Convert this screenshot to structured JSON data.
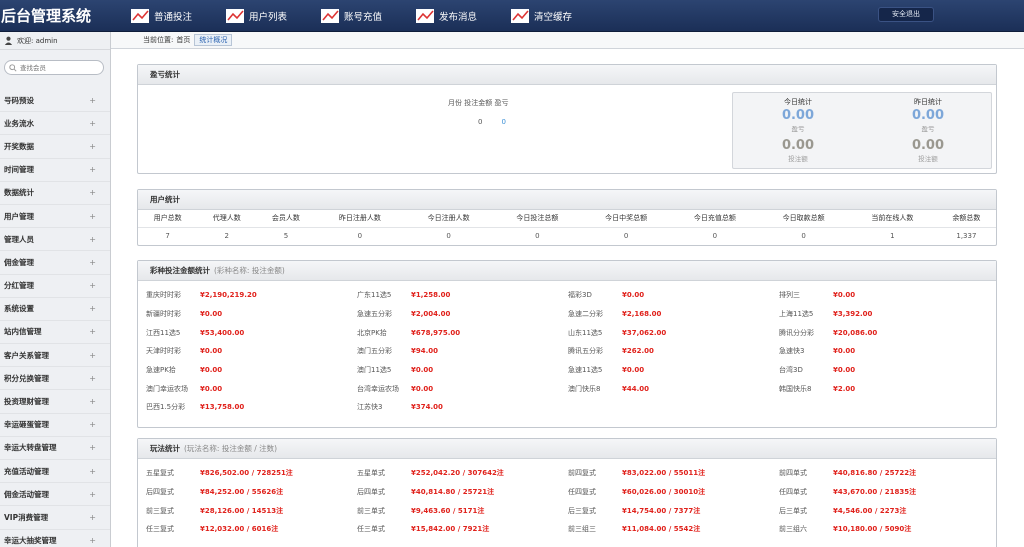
{
  "header": {
    "brand": "后台管理系统",
    "nav": [
      {
        "label": "普通投注",
        "icon": "chart-icon"
      },
      {
        "label": "用户列表",
        "icon": "chart-icon"
      },
      {
        "label": "账号充值",
        "icon": "chart-icon"
      },
      {
        "label": "发布消息",
        "icon": "chart-icon"
      },
      {
        "label": "清空缓存",
        "icon": "chart-icon"
      }
    ],
    "logout": "安全退出"
  },
  "sidebar": {
    "welcome": "欢迎: admin",
    "search_placeholder": "查找会员",
    "items": [
      "号码预设",
      "业务流水",
      "开奖数据",
      "时间管理",
      "数据统计",
      "用户管理",
      "管理人员",
      "佣金管理",
      "分红管理",
      "系统设置",
      "站内信管理",
      "客户关系管理",
      "积分兑换管理",
      "投资理财管理",
      "幸运砸蛋管理",
      "幸运大转盘管理",
      "充值活动管理",
      "佣金活动管理",
      "VIP消费管理",
      "幸运大抽奖管理"
    ]
  },
  "breadcrumb": {
    "prefix": "当前位置:",
    "home": "首页",
    "current": "统计概况"
  },
  "profit": {
    "title": "盈亏统计",
    "mid_header": "月份 投注金额 盈亏",
    "mid_v1": "0",
    "mid_v2": "0",
    "today_label": "今日统计",
    "yesterday_label": "昨日统计",
    "today_profit": "0.00",
    "today_bet": "0.00",
    "yesterday_profit": "0.00",
    "yesterday_bet": "0.00",
    "profit_label": "盈亏",
    "bet_label": "投注额"
  },
  "users": {
    "title": "用户统计",
    "headers": [
      "用户总数",
      "代理人数",
      "会员人数",
      "昨日注册人数",
      "今日注册人数",
      "今日投注总额",
      "今日中奖总额",
      "今日充值总额",
      "今日取款总额",
      "当前在线人数",
      "余额总数"
    ],
    "values": [
      "7",
      "2",
      "5",
      "0",
      "0",
      "0",
      "0",
      "0",
      "0",
      "1",
      "1,337"
    ]
  },
  "lottery": {
    "title": "彩种投注金额统计",
    "subtitle": "(彩种名称: 投注金额)",
    "rows": [
      [
        [
          "重庆时时彩",
          "¥2,190,219.20"
        ],
        [
          "广东11选5",
          "¥1,258.00"
        ],
        [
          "福彩3D",
          "¥0.00"
        ],
        [
          "排列三",
          "¥0.00"
        ]
      ],
      [
        [
          "新疆时时彩",
          "¥0.00"
        ],
        [
          "急速五分彩",
          "¥2,004.00"
        ],
        [
          "急速二分彩",
          "¥2,168.00"
        ],
        [
          "上海11选5",
          "¥3,392.00"
        ]
      ],
      [
        [
          "江西11选5",
          "¥53,400.00"
        ],
        [
          "北京PK拾",
          "¥678,975.00"
        ],
        [
          "山东11选5",
          "¥37,062.00"
        ],
        [
          "腾讯分分彩",
          "¥20,086.00"
        ]
      ],
      [
        [
          "天津时时彩",
          "¥0.00"
        ],
        [
          "澳门五分彩",
          "¥94.00"
        ],
        [
          "腾讯五分彩",
          "¥262.00"
        ],
        [
          "急速快3",
          "¥0.00"
        ]
      ],
      [
        [
          "急速PK拾",
          "¥0.00"
        ],
        [
          "澳门11选5",
          "¥0.00"
        ],
        [
          "急速11选5",
          "¥0.00"
        ],
        [
          "台湾3D",
          "¥0.00"
        ]
      ],
      [
        [
          "澳门幸运农场",
          "¥0.00"
        ],
        [
          "台湾幸运农场",
          "¥0.00"
        ],
        [
          "澳门快乐8",
          "¥44.00"
        ],
        [
          "韩国快乐8",
          "¥2.00"
        ]
      ],
      [
        [
          "巴西1.5分彩",
          "¥13,758.00"
        ],
        [
          "江苏快3",
          "¥374.00"
        ],
        [
          "",
          ""
        ],
        [
          "",
          ""
        ]
      ]
    ]
  },
  "play": {
    "title": "玩法统计",
    "subtitle": "(玩法名称: 投注金额 / 注数)",
    "rows": [
      [
        [
          "五星复式",
          "¥826,502.00 / 728251注"
        ],
        [
          "五星单式",
          "¥252,042.20 / 307642注"
        ],
        [
          "前四复式",
          "¥83,022.00 / 55011注"
        ],
        [
          "前四单式",
          "¥40,816.80 / 25722注"
        ]
      ],
      [
        [
          "后四复式",
          "¥84,252.00 / 55626注"
        ],
        [
          "后四单式",
          "¥40,814.80 / 25721注"
        ],
        [
          "任四复式",
          "¥60,026.00 / 30010注"
        ],
        [
          "任四单式",
          "¥43,670.00 / 21835注"
        ]
      ],
      [
        [
          "前三复式",
          "¥28,126.00 / 14513注"
        ],
        [
          "前三单式",
          "¥9,463.60 / 5171注"
        ],
        [
          "后三复式",
          "¥14,754.00 / 7377注"
        ],
        [
          "后三单式",
          "¥4,546.00 / 2273注"
        ]
      ],
      [
        [
          "任三复式",
          "¥12,032.00 / 6016注"
        ],
        [
          "任三单式",
          "¥15,842.00 / 7921注"
        ],
        [
          "前三组三",
          "¥11,084.00 / 5542注"
        ],
        [
          "前三组六",
          "¥10,180.00 / 5090注"
        ]
      ]
    ]
  }
}
